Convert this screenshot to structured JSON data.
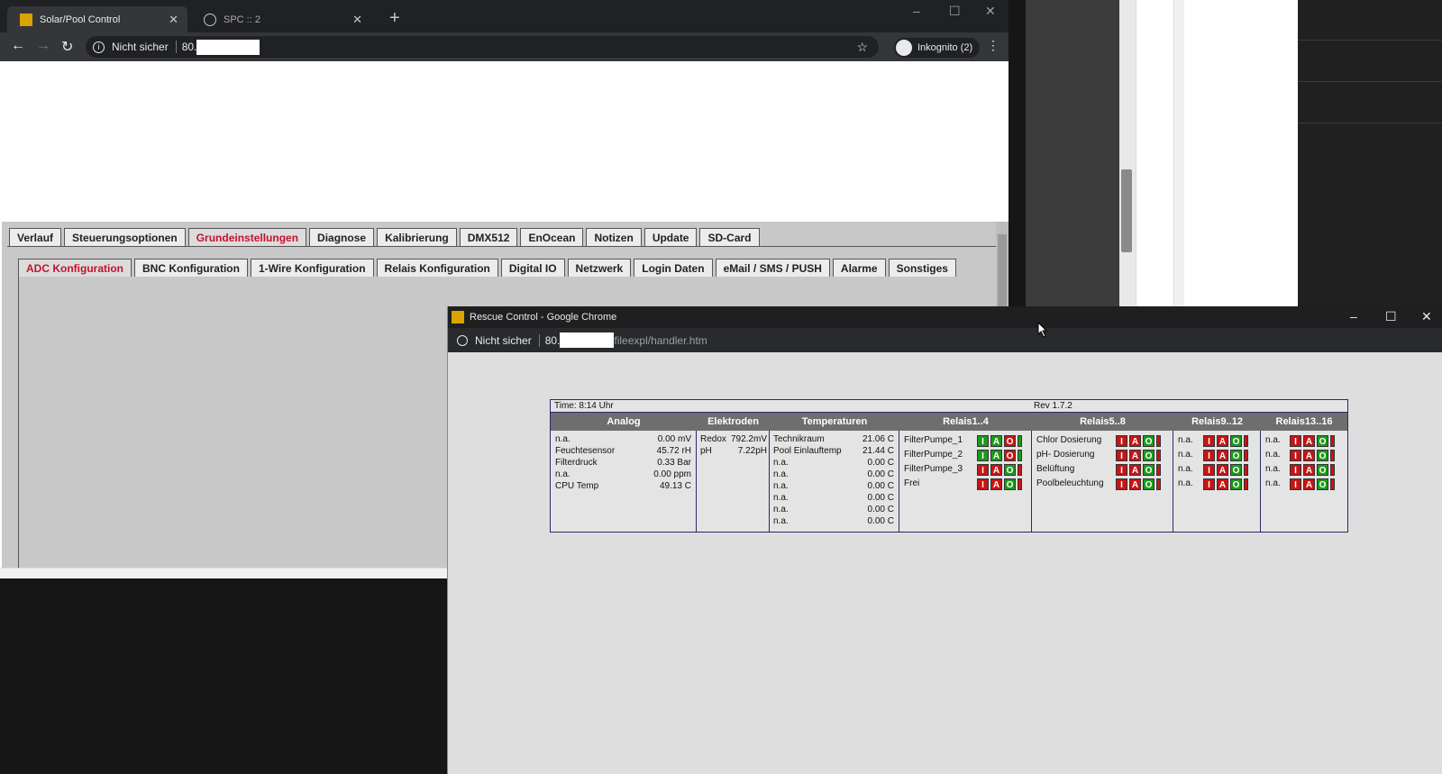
{
  "browser": {
    "tabs": [
      {
        "label": "Solar/Pool Control",
        "active": true
      },
      {
        "label": "SPC :: 2",
        "active": false
      }
    ],
    "new_tab": "+",
    "security_label": "Nicht sicher",
    "url_prefix": "80.",
    "incognito_label": "Inkognito (2)",
    "minimize": "–",
    "maximize": "☐",
    "close": "✕"
  },
  "main_tabs": [
    "Verlauf",
    "Steuerungsoptionen",
    "Grundeinstellungen",
    "Diagnose",
    "Kalibrierung",
    "DMX512",
    "EnOcean",
    "Notizen",
    "Update",
    "SD-Card"
  ],
  "main_tab_selected": "Grundeinstellungen",
  "sub_tabs": [
    "ADC Konfiguration",
    "BNC Konfiguration",
    "1-Wire Konfiguration",
    "Relais Konfiguration",
    "Digital IO",
    "Netzwerk",
    "Login Daten",
    "eMail / SMS / PUSH",
    "Alarme",
    "Sonstiges"
  ],
  "sub_tab_selected": "ADC Konfiguration",
  "popup": {
    "title": "Rescue Control - Google Chrome",
    "security_label": "Nicht sicher",
    "url_prefix": "80.",
    "url_suffix": "fileexpl/handler.htm",
    "minimize": "–",
    "maximize": "☐",
    "close": "✕"
  },
  "dashboard": {
    "time": "Time: 8:14 Uhr",
    "rev": "Rev 1.7.2",
    "headers": {
      "analog": "Analog",
      "elektroden": "Elektroden",
      "temperaturen": "Temperaturen",
      "relais1": "Relais1..4",
      "relais5": "Relais5..8",
      "relais9": "Relais9..12",
      "relais13": "Relais13..16"
    },
    "analog": [
      {
        "name": "n.a.",
        "value": "0.00 mV"
      },
      {
        "name": "Feuchtesensor",
        "value": "45.72 rH"
      },
      {
        "name": "Filterdruck",
        "value": "0.33 Bar"
      },
      {
        "name": "n.a.",
        "value": "0.00 ppm"
      },
      {
        "name": "CPU Temp",
        "value": "49.13 C"
      }
    ],
    "elektroden": [
      {
        "name": "Redox",
        "value": "792.2mV"
      },
      {
        "name": "pH",
        "value": "7.22pH"
      }
    ],
    "temperaturen": [
      {
        "name": "Technikraum",
        "value": "21.06 C"
      },
      {
        "name": "Pool Einlauftemp",
        "value": "21.44 C"
      },
      {
        "name": "n.a.",
        "value": "0.00 C"
      },
      {
        "name": "n.a.",
        "value": "0.00 C"
      },
      {
        "name": "n.a.",
        "value": "0.00 C"
      },
      {
        "name": "n.a.",
        "value": "0.00 C"
      },
      {
        "name": "n.a.",
        "value": "0.00 C"
      },
      {
        "name": "n.a.",
        "value": "0.00 C"
      }
    ],
    "relais1": [
      {
        "name": "FilterPumpe_1",
        "state": "on"
      },
      {
        "name": "FilterPumpe_2",
        "state": "on"
      },
      {
        "name": "FilterPumpe_3",
        "state": "off"
      },
      {
        "name": "Frei",
        "state": "off"
      }
    ],
    "relais5": [
      {
        "name": "Chlor Dosierung",
        "state": "off"
      },
      {
        "name": "pH- Dosierung",
        "state": "off"
      },
      {
        "name": "Belüftung",
        "state": "off"
      },
      {
        "name": "Poolbeleuchtung",
        "state": "off"
      }
    ],
    "relais9": [
      {
        "name": "n.a.",
        "state": "off"
      },
      {
        "name": "n.a.",
        "state": "off"
      },
      {
        "name": "n.a.",
        "state": "off"
      },
      {
        "name": "n.a.",
        "state": "off"
      }
    ],
    "relais13": [
      {
        "name": "n.a.",
        "state": "off"
      },
      {
        "name": "n.a.",
        "state": "off"
      },
      {
        "name": "n.a.",
        "state": "off"
      },
      {
        "name": "n.a.",
        "state": "off"
      }
    ],
    "iao_letters": [
      "I",
      "A",
      "O"
    ],
    "colors": {
      "on": "#1a9a1a",
      "off": "#c81414",
      "selected_tab": "#c8102e"
    }
  }
}
